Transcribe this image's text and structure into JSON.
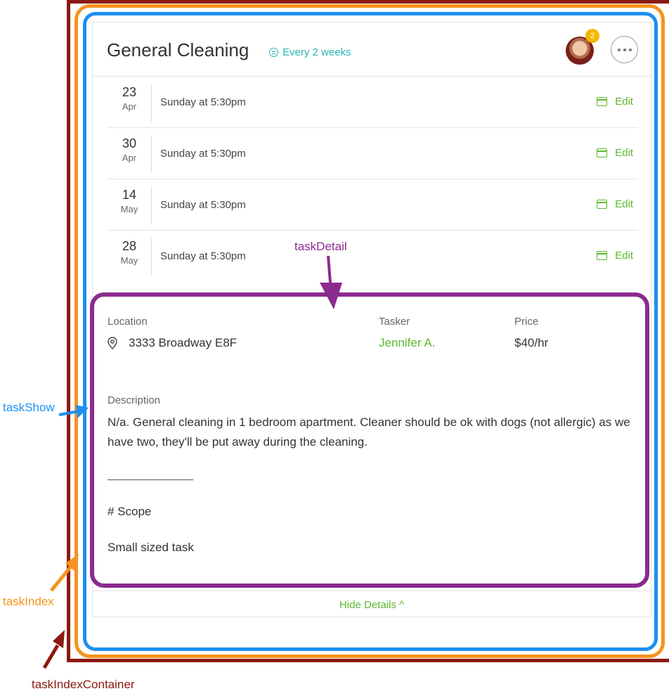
{
  "annotations": {
    "task_detail": "taskDetail",
    "task_show": "taskShow",
    "task_index": "taskIndex",
    "task_index_container": "taskIndexContainer"
  },
  "header": {
    "title": "General Cleaning",
    "frequency": "Every 2 weeks",
    "avatar_badge_count": "2"
  },
  "schedule": [
    {
      "day": "23",
      "month": "Apr",
      "time": "Sunday at 5:30pm",
      "edit_label": "Edit"
    },
    {
      "day": "30",
      "month": "Apr",
      "time": "Sunday at 5:30pm",
      "edit_label": "Edit"
    },
    {
      "day": "14",
      "month": "May",
      "time": "Sunday at 5:30pm",
      "edit_label": "Edit"
    },
    {
      "day": "28",
      "month": "May",
      "time": "Sunday at 5:30pm",
      "edit_label": "Edit"
    }
  ],
  "details": {
    "location_label": "Location",
    "location_value": "3333 Broadway E8F",
    "tasker_label": "Tasker",
    "tasker_value": "Jennifer A.",
    "price_label": "Price",
    "price_value": "$40/hr",
    "description_label": "Description",
    "description_text": "N/a. General cleaning in 1 bedroom apartment. Cleaner should be ok with dogs (not allergic) as we have two, they'll be put away during the cleaning.",
    "scope_heading": "# Scope",
    "scope_text": "Small sized task"
  },
  "footer": {
    "hide_details_label": "Hide Details ^"
  },
  "colors": {
    "accent_green": "#5cb82e",
    "frequency_teal": "#2ab5b3",
    "task_detail_annotation": "#8b2a8f",
    "task_show_annotation": "#1e8ff0",
    "task_index_annotation": "#f7931e",
    "task_index_container_annotation": "#8b1a10"
  }
}
